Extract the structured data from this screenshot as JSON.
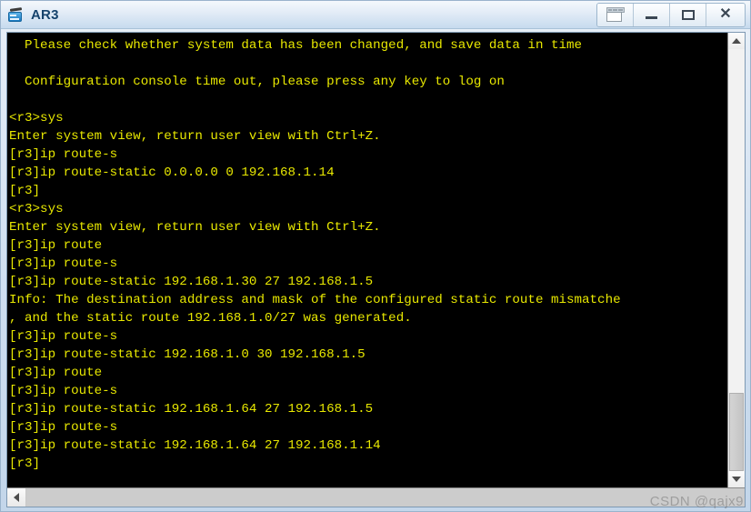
{
  "window": {
    "title": "AR3",
    "icon": "router-icon",
    "controls": [
      {
        "name": "detach-button",
        "label": "Detach"
      },
      {
        "name": "minimize-button",
        "label": "_"
      },
      {
        "name": "maximize-button",
        "label": "Maximize"
      },
      {
        "name": "close-button",
        "label": "X"
      }
    ]
  },
  "colors": {
    "terminal_bg": "#000000",
    "terminal_fg": "#e8e800",
    "titlebar_text": "#16436c",
    "window_bg": "#c3d6ea"
  },
  "terminal": {
    "lines": [
      "  Please check whether system data has been changed, and save data in time",
      "",
      "  Configuration console time out, please press any key to log on",
      "",
      "<r3>sys",
      "Enter system view, return user view with Ctrl+Z.",
      "[r3]ip route-s",
      "[r3]ip route-static 0.0.0.0 0 192.168.1.14",
      "[r3]",
      "<r3>sys",
      "Enter system view, return user view with Ctrl+Z.",
      "[r3]ip route",
      "[r3]ip route-s",
      "[r3]ip route-static 192.168.1.30 27 192.168.1.5",
      "Info: The destination address and mask of the configured static route mismatche",
      ", and the static route 192.168.1.0/27 was generated.",
      "[r3]ip route-s",
      "[r3]ip route-static 192.168.1.0 30 192.168.1.5",
      "[r3]ip route",
      "[r3]ip route-s",
      "[r3]ip route-static 192.168.1.64 27 192.168.1.5",
      "[r3]ip route-s",
      "[r3]ip route-static 192.168.1.64 27 192.168.1.14",
      "[r3]"
    ]
  },
  "scrollbars": {
    "vertical": {
      "up_label": "scroll up",
      "down_label": "scroll down"
    },
    "horizontal": {
      "left_label": "scroll left"
    }
  },
  "watermark": {
    "text": "CSDN @qajx9"
  }
}
